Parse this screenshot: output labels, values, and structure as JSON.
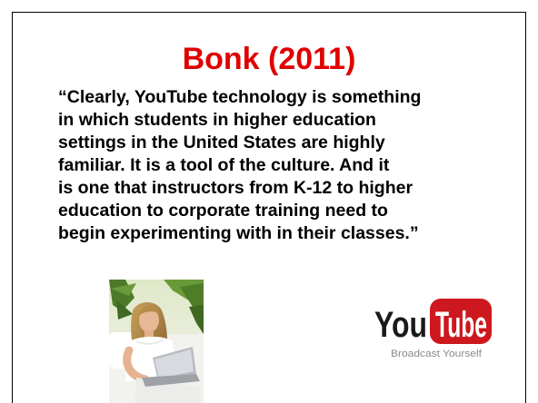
{
  "slide": {
    "title": "Bonk (2011)",
    "quote": "“Clearly, YouTube technology is something\nin which students in higher education\nsettings in the United States are highly\nfamiliar. It is a tool of the culture.  And it\nis one that instructors from K-12 to higher\neducation to corporate training need to\nbegin experimenting with in their classes.”"
  },
  "logo": {
    "word_you": "You",
    "word_tube": "Tube",
    "tagline": "Broadcast Yourself"
  },
  "colors": {
    "title": "#e00000",
    "youtube_red": "#cc181e"
  }
}
